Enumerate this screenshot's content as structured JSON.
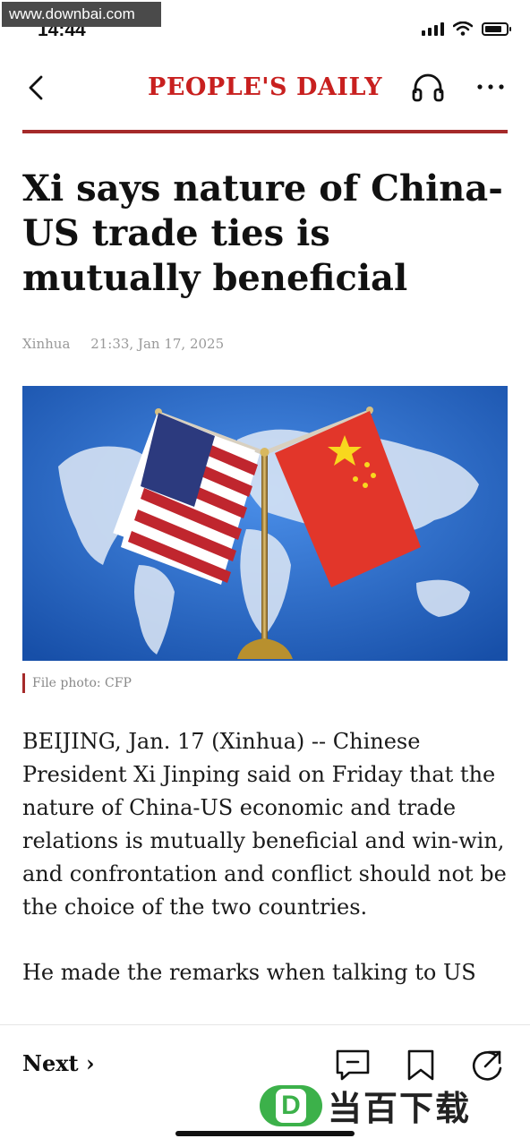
{
  "watermark": {
    "top": "www.downbai.com",
    "bottom_logo": "D",
    "bottom_text": "当百下载"
  },
  "status_bar": {
    "time": "14:44"
  },
  "header": {
    "brand": "PEOPLE'S DAILY"
  },
  "article": {
    "headline": "Xi says nature of China-US trade ties is mutually beneficial",
    "source": "Xinhua",
    "timestamp": "21:33, Jan 17, 2025",
    "caption": "File photo: CFP",
    "paragraphs": [
      " BEIJING, Jan. 17 (Xinhua) -- Chinese President Xi Jinping said on Friday that the nature of China-US economic and trade relations is mutually beneficial and win-win, and confrontation and conflict should not be the choice of the two countries.",
      "He made the remarks when talking to US"
    ]
  },
  "bottom_bar": {
    "next_label": "Next ›"
  },
  "colors": {
    "brand_red": "#c8201f",
    "rule": "#a52a2a",
    "map_blue": "#1f63c4"
  },
  "icons": [
    "back-chevron-icon",
    "headphones-icon",
    "more-dots-icon",
    "comment-icon",
    "bookmark-icon",
    "share-icon"
  ]
}
